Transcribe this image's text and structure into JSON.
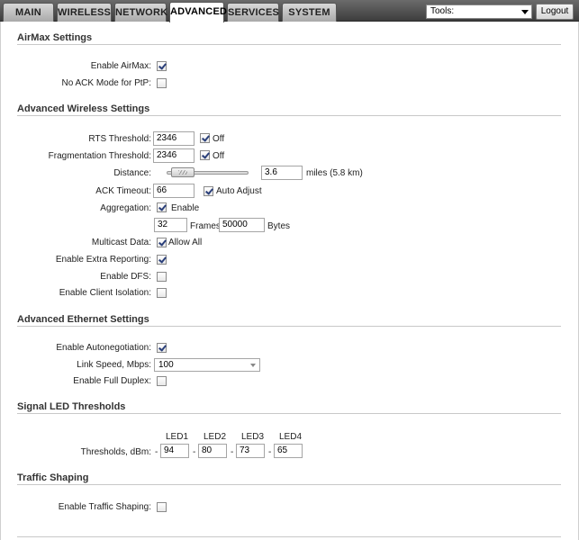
{
  "nav": {
    "tabs": [
      {
        "label": "MAIN"
      },
      {
        "label": "WIRELESS"
      },
      {
        "label": "NETWORK"
      },
      {
        "label": "ADVANCED",
        "active": true
      },
      {
        "label": "SERVICES"
      },
      {
        "label": "SYSTEM"
      }
    ],
    "tools_select": "Tools:",
    "logout_label": "Logout"
  },
  "airmax": {
    "title": "AirMax Settings",
    "enable_airmax": {
      "label": "Enable AirMax:",
      "checked": true
    },
    "no_ack": {
      "label": "No ACK Mode for PtP:",
      "checked": false
    }
  },
  "wireless": {
    "title": "Advanced Wireless Settings",
    "rts": {
      "label": "RTS Threshold:",
      "value": "2346",
      "off_label": "Off",
      "off_checked": true
    },
    "frag": {
      "label": "Fragmentation Threshold:",
      "value": "2346",
      "off_label": "Off",
      "off_checked": true
    },
    "distance": {
      "label": "Distance:",
      "value": "3.6",
      "unit": "miles (5.8 km)"
    },
    "ack": {
      "label": "ACK Timeout:",
      "value": "66",
      "auto_label": "Auto Adjust",
      "auto_checked": true
    },
    "aggregation": {
      "label": "Aggregation:",
      "enable_label": "Enable",
      "checked": true,
      "frames_value": "32",
      "frames_label": "Frames",
      "bytes_value": "50000",
      "bytes_label": "Bytes"
    },
    "multicast": {
      "label": "Multicast Data:",
      "allow_label": "Allow All",
      "checked": true
    },
    "extra_reporting": {
      "label": "Enable Extra Reporting:",
      "checked": true
    },
    "dfs": {
      "label": "Enable DFS:",
      "checked": false
    },
    "client_isolation": {
      "label": "Enable Client Isolation:",
      "checked": false
    }
  },
  "ethernet": {
    "title": "Advanced Ethernet Settings",
    "autoneg": {
      "label": "Enable Autonegotiation:",
      "checked": true
    },
    "link_speed": {
      "label": "Link Speed, Mbps:",
      "value": "100"
    },
    "full_duplex": {
      "label": "Enable Full Duplex:",
      "checked": false
    }
  },
  "led": {
    "title": "Signal LED Thresholds",
    "label": "Thresholds, dBm:",
    "sign": "-",
    "leds": [
      {
        "name": "LED1",
        "value": "94"
      },
      {
        "name": "LED2",
        "value": "80"
      },
      {
        "name": "LED3",
        "value": "73"
      },
      {
        "name": "LED4",
        "value": "65"
      }
    ]
  },
  "traffic": {
    "title": "Traffic Shaping",
    "enable": {
      "label": "Enable Traffic Shaping:",
      "checked": false
    }
  }
}
